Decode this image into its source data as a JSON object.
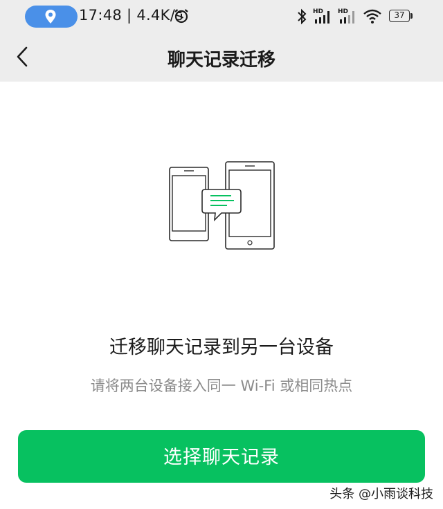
{
  "status_bar": {
    "time_speed": "17:48 | 4.4K/s",
    "battery_level": "37",
    "network_badge": "HD",
    "icons": [
      "location-icon",
      "alarm-icon",
      "bluetooth-icon",
      "signal-hd-icon",
      "signal-hd-icon",
      "wifi-icon",
      "battery-icon"
    ],
    "location_pill_color": "#4a90e8"
  },
  "nav": {
    "back_icon": "chevron-left-icon",
    "title": "聊天记录迁移"
  },
  "content": {
    "illustration_icon": "phones-transfer-icon",
    "heading": "迁移聊天记录到另一台设备",
    "subtext": "请将两台设备接入同一 Wi-Fi 或相同热点"
  },
  "action": {
    "primary_label": "选择聊天记录",
    "primary_color": "#07c160"
  },
  "watermark": {
    "text": "头条 @小雨谈科技"
  }
}
